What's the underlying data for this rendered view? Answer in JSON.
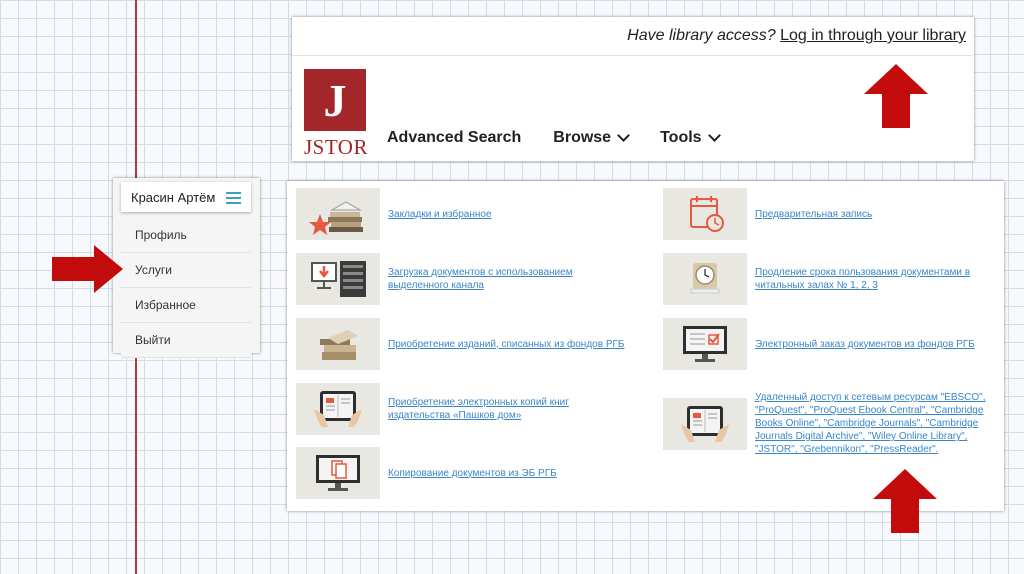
{
  "jstor": {
    "access_question": "Have library access?",
    "access_link": "Log in through your library",
    "logo_letter": "J",
    "logo_word": "JSTOR",
    "nav": [
      "Advanced Search",
      "Browse",
      "Tools"
    ]
  },
  "user_menu": {
    "name": "Красин Артём",
    "items": [
      "Профиль",
      "Услуги",
      "Избранное",
      "Выйти"
    ]
  },
  "services": {
    "left": [
      "Закладки и избранное",
      "Загрузка документов с использованием выделенного канала",
      "Приобретение изданий, списанных из фондов РГБ",
      "Приобретение электронных копий книг издательства «Пашков дом»",
      "Копирование документов из ЭБ РГБ"
    ],
    "right": [
      "Предварительная запись",
      "Продление срока пользования документами в читальных залах № 1, 2, 3",
      "Электронный заказ документов из фондов РГБ",
      "Удаленный доступ к сетевым ресурсам \"EBSCO\", \"ProQuest\", \"ProQuest Ebook Central\", \"Cambridge Books Online\", \"Cambridge Journals\", \"Cambridge Journals Digital Archive\", \"Wiley Online Library\", \"JSTOR\", \"Grebennikon\", \"PressReader\"."
    ]
  },
  "colors": {
    "arrow": "#c40b0b",
    "link": "#3a86c8",
    "jstor_red": "#a3262b",
    "accent": "#e8583f"
  }
}
